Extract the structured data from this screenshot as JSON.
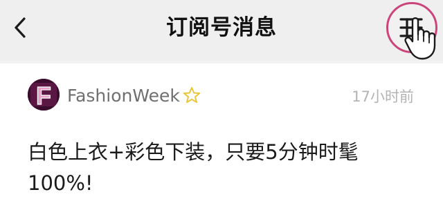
{
  "nav": {
    "back_icon": "chevron-left-icon",
    "title": "订阅号消息",
    "menu_icon": "list-menu-icon",
    "pointer_icon": "hand-pointer-icon",
    "highlight_color": "#c9457a"
  },
  "message": {
    "avatar_letter": "F",
    "avatar_color": "#e6a2c8",
    "account_name": "FashionWeek",
    "star_icon": "star-outline-icon",
    "star_color": "#e8c63a",
    "timestamp": "17小时前",
    "text": "白色上衣+彩色下装，只要5分钟时髦100%!"
  }
}
